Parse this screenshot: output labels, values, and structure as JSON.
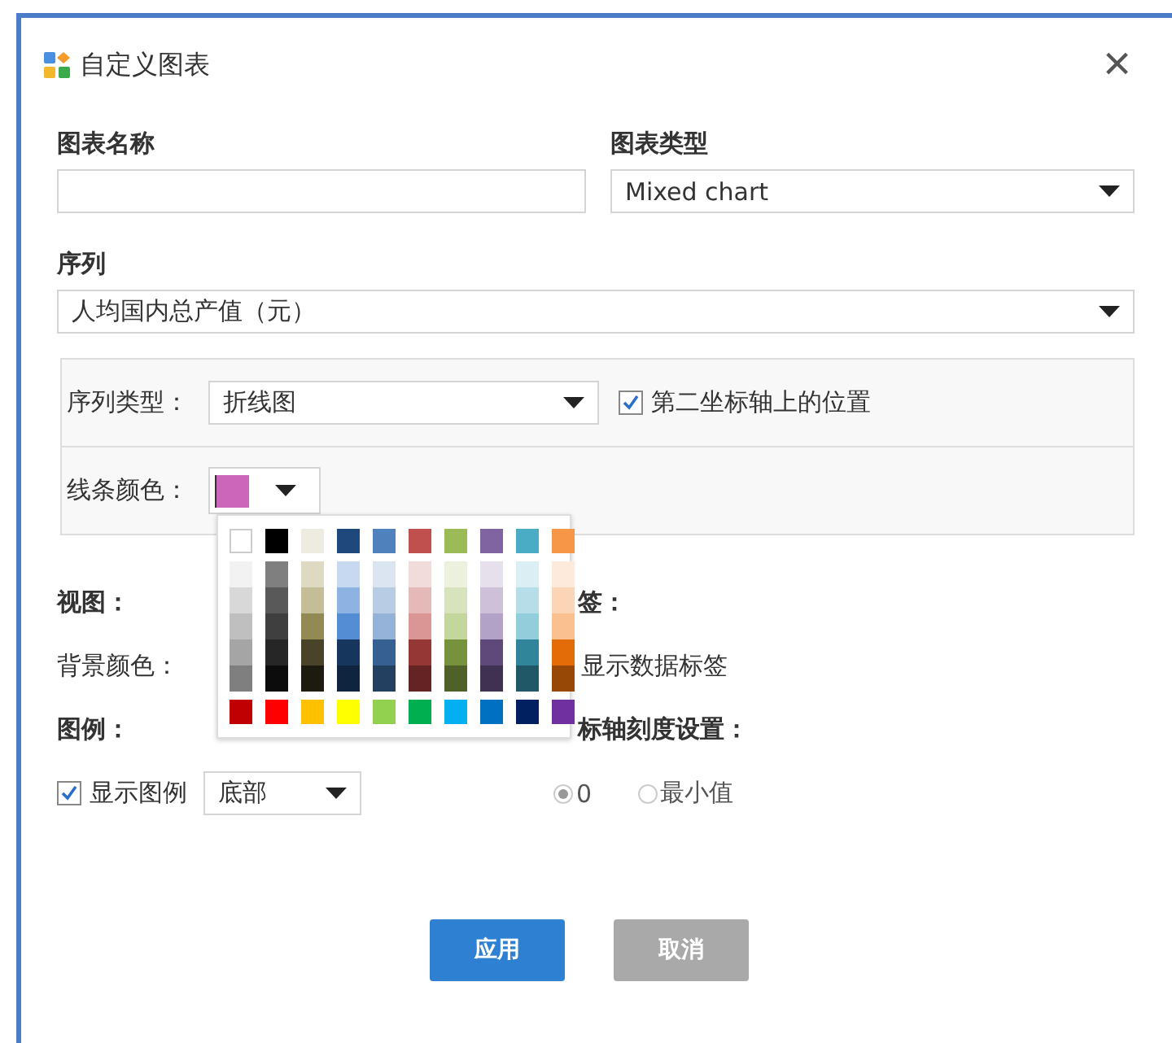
{
  "dialog": {
    "title": "自定义图表",
    "close": "×"
  },
  "chart_name": {
    "label": "图表名称"
  },
  "chart_type": {
    "label": "图表类型",
    "value": "Mixed chart"
  },
  "series": {
    "label": "序列",
    "value": "人均国内总产值（元）"
  },
  "series_panel": {
    "type_label": "序列类型：",
    "type_value": "折线图",
    "secondary_axis": {
      "label": "第二坐标轴上的位置",
      "checked": true
    },
    "line_color_label": "线条颜色："
  },
  "palette": {
    "theme": [
      {
        "color": "#ffffff"
      },
      {
        "color": "#000000"
      },
      {
        "color": "#eeece1"
      },
      {
        "color": "#1f497d"
      },
      {
        "color": "#4f81bd"
      },
      {
        "color": "#c0504d"
      },
      {
        "color": "#9bbb59"
      },
      {
        "color": "#8064a2"
      },
      {
        "color": "#4bacc6"
      },
      {
        "color": "#f79646"
      }
    ],
    "shades": [
      [
        {
          "color": "#f2f2f2"
        },
        {
          "color": "#d8d8d8"
        },
        {
          "color": "#bfbfbf"
        },
        {
          "color": "#a5a5a5"
        },
        {
          "color": "#7f7f7f"
        }
      ],
      [
        {
          "color": "#7f7f7f"
        },
        {
          "color": "#595959"
        },
        {
          "color": "#3f3f3f"
        },
        {
          "color": "#262626"
        },
        {
          "color": "#0c0c0c"
        }
      ],
      [
        {
          "color": "#ddd9c3"
        },
        {
          "color": "#c4bd97"
        },
        {
          "color": "#938953"
        },
        {
          "color": "#494429"
        },
        {
          "color": "#1d1b10"
        }
      ],
      [
        {
          "color": "#c6d9f0"
        },
        {
          "color": "#8db3e2"
        },
        {
          "color": "#548dd4"
        },
        {
          "color": "#17365d"
        },
        {
          "color": "#0f243e"
        }
      ],
      [
        {
          "color": "#dbe5f1"
        },
        {
          "color": "#b8cce4"
        },
        {
          "color": "#95b3d7"
        },
        {
          "color": "#366092"
        },
        {
          "color": "#244061"
        }
      ],
      [
        {
          "color": "#f2dcdb"
        },
        {
          "color": "#e5b9b7"
        },
        {
          "color": "#d99694"
        },
        {
          "color": "#953734"
        },
        {
          "color": "#632423"
        }
      ],
      [
        {
          "color": "#ebf1dd"
        },
        {
          "color": "#d7e3bc"
        },
        {
          "color": "#c3d69b"
        },
        {
          "color": "#76923c"
        },
        {
          "color": "#4f6128"
        }
      ],
      [
        {
          "color": "#e5e0ec"
        },
        {
          "color": "#ccc1d9"
        },
        {
          "color": "#b2a2c7"
        },
        {
          "color": "#5f497a"
        },
        {
          "color": "#3f3151"
        }
      ],
      [
        {
          "color": "#dbeef3"
        },
        {
          "color": "#b7dde8"
        },
        {
          "color": "#92cddc"
        },
        {
          "color": "#31859b"
        },
        {
          "color": "#205867"
        }
      ],
      [
        {
          "color": "#fdeada"
        },
        {
          "color": "#fbd5b5"
        },
        {
          "color": "#fac08f"
        },
        {
          "color": "#e36c09"
        },
        {
          "color": "#974806"
        }
      ]
    ],
    "standard": [
      {
        "color": "#c00000"
      },
      {
        "color": "#ff0000"
      },
      {
        "color": "#ffc000"
      },
      {
        "color": "#ffff00"
      },
      {
        "color": "#92d050"
      },
      {
        "color": "#00b050"
      },
      {
        "color": "#00b0f0"
      },
      {
        "color": "#0070c0"
      },
      {
        "color": "#002060"
      },
      {
        "color": "#7030a0"
      }
    ]
  },
  "view": {
    "label": "视图：",
    "background_label": "背景颜色："
  },
  "data_labels": {
    "label": "签：",
    "show": {
      "label": "显示数据标签"
    }
  },
  "legend": {
    "label": "图例：",
    "show": {
      "label": "显示图例",
      "checked": true
    },
    "position": "底部"
  },
  "axis": {
    "label": "标轴刻度设置：",
    "options": [
      {
        "label": "0",
        "selected": true
      },
      {
        "label": "最小值",
        "selected": false
      }
    ]
  },
  "buttons": [
    {
      "label": "应用",
      "disabled": false
    },
    {
      "label": "取消",
      "disabled": true
    }
  ]
}
